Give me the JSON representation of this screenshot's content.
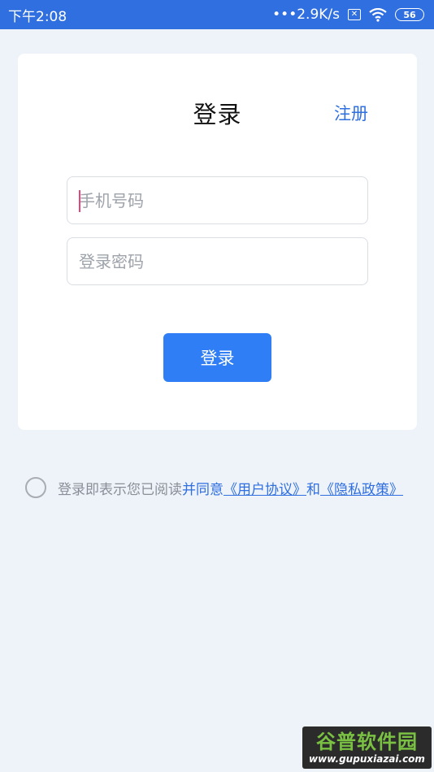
{
  "status_bar": {
    "time": "下午2:08",
    "network_speed": "•••2.9K/s",
    "sim_icon": "sim-x-icon",
    "wifi_icon": "wifi-icon",
    "battery": "56"
  },
  "card": {
    "title": "登录",
    "register_label": "注册",
    "phone_placeholder": "手机号码",
    "password_placeholder": "登录密码",
    "login_button": "登录"
  },
  "agreement": {
    "prefix": "登录即表示您已阅读",
    "conj1": "并同意",
    "user_agreement": "《用户协议》",
    "conj2": "和",
    "privacy_policy": "《隐私政策》",
    "checked": false
  },
  "watermark": {
    "title": "谷普软件园",
    "url": "www.gupuxiazai.com"
  },
  "colors": {
    "accent": "#2f6fe0",
    "button": "#2f7ef5",
    "background": "#eef2f9"
  }
}
